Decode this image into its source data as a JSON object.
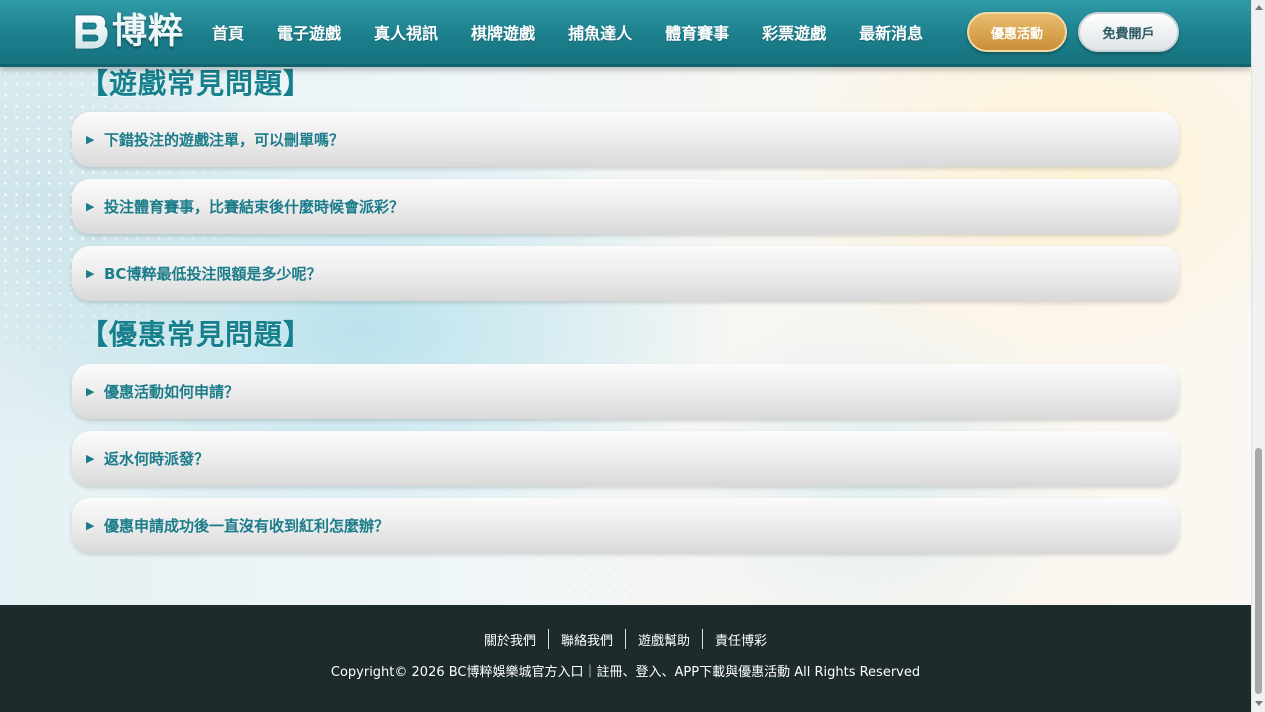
{
  "header": {
    "logo_text": "博粹",
    "nav": [
      "首頁",
      "電子遊戲",
      "真人視訊",
      "棋牌遊戲",
      "捕魚達人",
      "體育賽事",
      "彩票遊戲",
      "最新消息"
    ],
    "promo_label": "優惠活動",
    "open_account_label": "免費開戶"
  },
  "sections": [
    {
      "title": "【遊戲常見問題】",
      "questions": [
        "下錯投注的遊戲注單，可以刪單嗎？",
        "投注體育賽事，比賽結束後什麼時候會派彩？",
        "BC博粹最低投注限額是多少呢？"
      ]
    },
    {
      "title": "【優惠常見問題】",
      "questions": [
        "優惠活動如何申請？",
        "返水何時派發？",
        "優惠申請成功後一直沒有收到紅利怎麼辦？"
      ]
    }
  ],
  "footer": {
    "links": [
      "關於我們",
      "聯絡我們",
      "遊戲幫助",
      "責任博彩"
    ],
    "copyright": "Copyright© 2026 BC博粹娛樂城官方入口｜註冊、登入、APP下載與優惠活動 All Rights Reserved"
  },
  "icons": {
    "faq_arrow": "▶"
  },
  "colors": {
    "brand_teal": "#1b7c8a",
    "promo_gold": "#d9a24c",
    "footer_bg": "#1e2b2d"
  }
}
